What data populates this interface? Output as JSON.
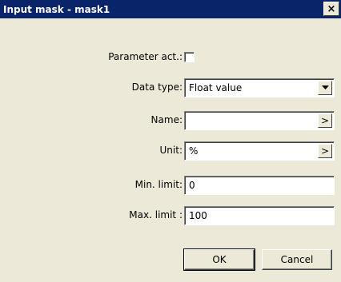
{
  "window": {
    "title": "Input mask - mask1",
    "close_label": "×"
  },
  "form": {
    "parameter_act_label": "Parameter act.:",
    "data_type_label": "Data type:",
    "data_type_value": "Float value",
    "name_label": "Name:",
    "name_value": "",
    "unit_label": "Unit:",
    "unit_value": "%",
    "min_label": "Min. limit:",
    "min_value": "0",
    "max_label": "Max. limit :",
    "max_value": "100",
    "browse_label": ">"
  },
  "buttons": {
    "ok": "OK",
    "cancel": "Cancel"
  }
}
